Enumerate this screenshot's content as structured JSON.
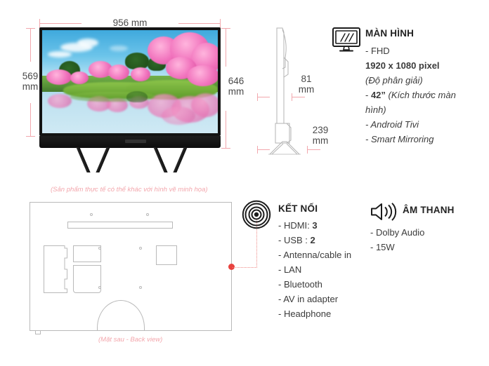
{
  "dimensions": {
    "width_label": "956 mm",
    "height_panel_label": "569\nmm",
    "height_panel_line1": "569",
    "height_panel_line2": "mm",
    "height_total_line1": "646",
    "height_total_line2": "mm",
    "depth_line1": "81",
    "depth_line2": "mm",
    "stand_depth_line1": "239",
    "stand_depth_line2": "mm"
  },
  "captions": {
    "disclaimer": "(Sản phẩm thực tế có thể khác với hình vẽ minh họa)",
    "backview": "(Mặt sau - Back view)"
  },
  "display": {
    "icon": "monitor-icon",
    "title": "MÀN HÌNH",
    "lines": [
      {
        "text": "- FHD",
        "style": "normal"
      },
      {
        "text": "1920 x 1080 pixel",
        "style": "bold"
      },
      {
        "text": "(Độ phân giải)",
        "style": "italic"
      },
      {
        "text": "- 42” (Kích thước màn hình)",
        "style": "mixed"
      },
      {
        "text": "- Android Tivi",
        "style": "italic"
      },
      {
        "text": "- Smart Mirroring",
        "style": "italic"
      }
    ],
    "line_fhd": "- FHD",
    "line_resolution": "1920 x 1080 pixel",
    "line_resolution_note": "(Độ phân giải)",
    "line_size_dash": "- ",
    "line_size_value": "42”",
    "line_size_note": " (Kích thước màn",
    "line_size_note2": "hình)",
    "line_android": "- Android Tivi",
    "line_mirroring": "- Smart Mirroring"
  },
  "connectivity": {
    "icon": "antenna-signal-icon",
    "title": "KẾT NỐI",
    "items": [
      {
        "label": "- HDMI: ",
        "value": "3"
      },
      {
        "label": "- USB : ",
        "value": "2"
      },
      {
        "label": "- Antenna/cable in",
        "value": ""
      },
      {
        "label": "- LAN",
        "value": ""
      },
      {
        "label": "- Bluetooth",
        "value": ""
      },
      {
        "label": "- AV in adapter",
        "value": ""
      },
      {
        "label": "- Headphone",
        "value": ""
      }
    ]
  },
  "audio": {
    "icon": "speaker-icon",
    "title": "ÂM THANH",
    "items": [
      "- Dolby Audio",
      "- 15W"
    ]
  },
  "colors": {
    "dimension_line": "#f2a7ad",
    "caption_text": "#f3a6ac",
    "outline": "#b9b9b9",
    "marker_dot": "#e8433f",
    "text": "#3b3b3b"
  }
}
